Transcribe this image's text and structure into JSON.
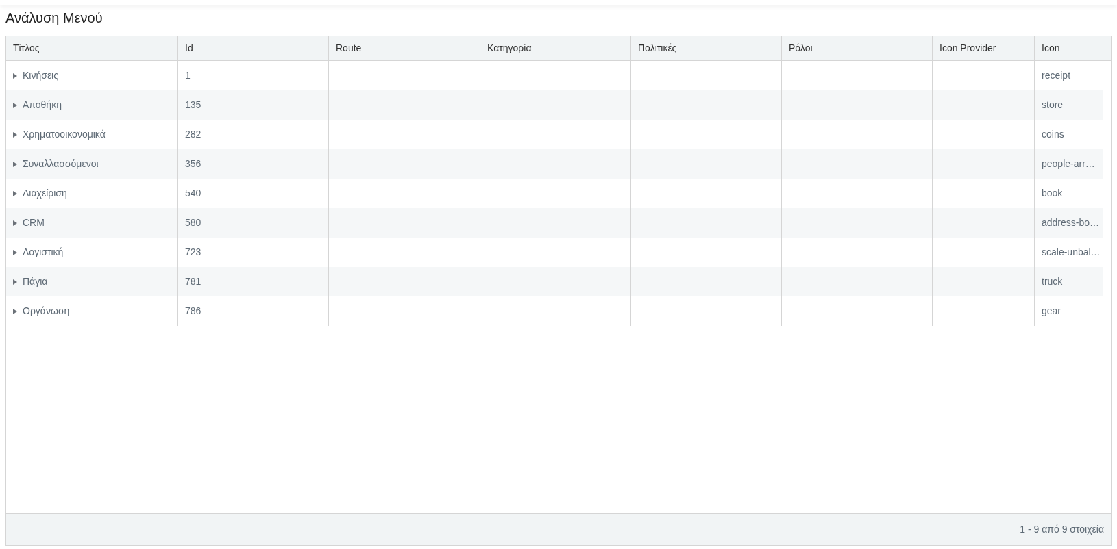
{
  "page_title": "Ανάλυση Μενού",
  "table": {
    "columns": [
      "Τίτλος",
      "Id",
      "Route",
      "Κατηγορία",
      "Πολιτικές",
      "Ρόλοι",
      "Icon Provider",
      "Icon"
    ],
    "rows": [
      {
        "title": "Κινήσεις",
        "id": "1",
        "icon": "receipt",
        "expanded": false
      },
      {
        "title": "Αποθήκη",
        "id": "135",
        "icon": "store",
        "expanded": false
      },
      {
        "title": "Χρηματοοικονομικά",
        "id": "282",
        "icon": "coins",
        "expanded": false
      },
      {
        "title": "Συναλλασσόμενοι",
        "id": "356",
        "icon": "people-arr…",
        "expanded": false
      },
      {
        "title": "Διαχείριση",
        "id": "540",
        "icon": "book",
        "expanded": false
      },
      {
        "title": "CRM",
        "id": "580",
        "icon": "address-bo…",
        "expanded": false
      },
      {
        "title": "Λογιστική",
        "id": "723",
        "icon": "scale-unbal…",
        "expanded": false
      },
      {
        "title": "Πάγια",
        "id": "781",
        "icon": "truck",
        "expanded": false
      },
      {
        "title": "Οργάνωση",
        "id": "786",
        "icon": "gear",
        "expanded": false
      }
    ]
  },
  "pager": {
    "summary": "1 - 9 από 9 στοιχεία"
  }
}
